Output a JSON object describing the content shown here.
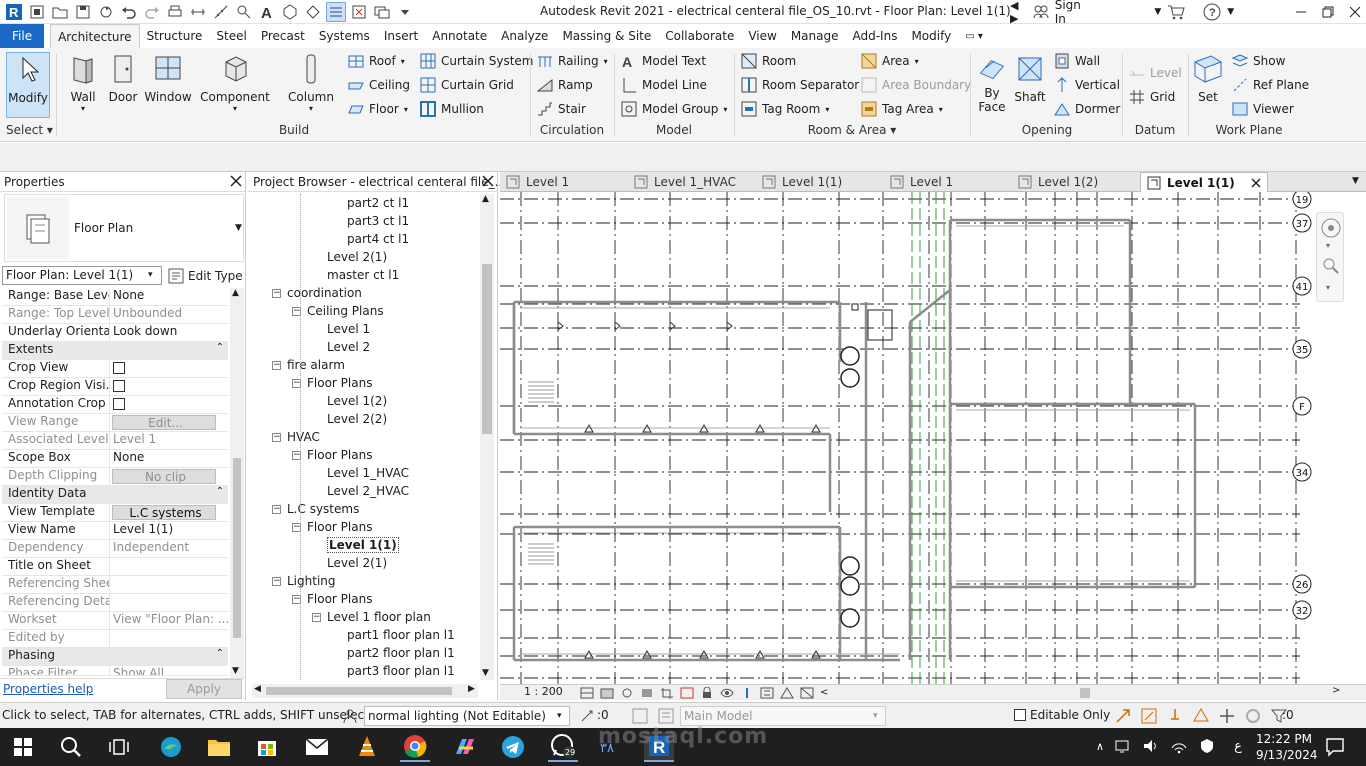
{
  "window": {
    "title": "Autodesk Revit 2021 - electrical centeral file_OS_10.rvt - Floor Plan: Level 1(1)",
    "sign_in": "Sign In"
  },
  "ribbon_tabs": [
    "File",
    "Architecture",
    "Structure",
    "Steel",
    "Precast",
    "Systems",
    "Insert",
    "Annotate",
    "Analyze",
    "Massing & Site",
    "Collaborate",
    "View",
    "Manage",
    "Add-Ins",
    "Modify"
  ],
  "ribbon": {
    "select": {
      "modify": "Modify",
      "label": "Select"
    },
    "build": {
      "wall": "Wall",
      "door": "Door",
      "window": "Window",
      "component": "Component",
      "column": "Column",
      "roof": "Roof",
      "ceiling": "Ceiling",
      "floor": "Floor",
      "curtain_system": "Curtain System",
      "curtain_grid": "Curtain Grid",
      "mullion": "Mullion",
      "label": "Build"
    },
    "circulation": {
      "railing": "Railing",
      "ramp": "Ramp",
      "stair": "Stair",
      "label": "Circulation"
    },
    "model": {
      "model_text": "Model Text",
      "model_line": "Model Line",
      "model_group": "Model Group",
      "label": "Model"
    },
    "room_area": {
      "room": "Room",
      "room_separator": "Room Separator",
      "tag_room": "Tag Room",
      "area": "Area",
      "area_boundary": "Area Boundary",
      "tag_area": "Tag Area",
      "label": "Room & Area"
    },
    "opening": {
      "by_face_1": "By",
      "by_face_2": "Face",
      "shaft": "Shaft",
      "wall": "Wall",
      "vertical": "Vertical",
      "dormer": "Dormer",
      "label": "Opening"
    },
    "datum": {
      "level": "Level",
      "grid": "Grid",
      "label": "Datum"
    },
    "work_plane": {
      "set": "Set",
      "show": "Show",
      "ref_plane": "Ref Plane",
      "viewer": "Viewer",
      "label": "Work Plane"
    }
  },
  "properties": {
    "title": "Properties",
    "type_name": "Floor Plan",
    "selector": "Floor Plan: Level 1(1)",
    "edit_type": "Edit Type",
    "rows": [
      {
        "k": "Range: Base Level",
        "v": "None"
      },
      {
        "k": "Range: Top Level",
        "v": "Unbounded"
      },
      {
        "k": "Underlay Orienta...",
        "v": "Look down"
      }
    ],
    "extents_label": "Extents",
    "extents": [
      {
        "k": "Crop View",
        "v": ""
      },
      {
        "k": "Crop Region Visi...",
        "v": ""
      },
      {
        "k": "Annotation Crop",
        "v": ""
      },
      {
        "k": "View Range",
        "v": "Edit..."
      },
      {
        "k": "Associated Level",
        "v": "Level 1"
      },
      {
        "k": "Scope Box",
        "v": "None"
      },
      {
        "k": "Depth Clipping",
        "v": "No clip"
      }
    ],
    "identity_label": "Identity Data",
    "identity": [
      {
        "k": "View Template",
        "v": "L.C systems"
      },
      {
        "k": "View Name",
        "v": "Level 1(1)"
      },
      {
        "k": "Dependency",
        "v": "Independent"
      },
      {
        "k": "Title on Sheet",
        "v": ""
      },
      {
        "k": "Referencing Sheet",
        "v": ""
      },
      {
        "k": "Referencing Detail",
        "v": ""
      },
      {
        "k": "Workset",
        "v": "View \"Floor Plan: ..."
      },
      {
        "k": "Edited by",
        "v": ""
      }
    ],
    "phasing_label": "Phasing",
    "phase_filter": {
      "k": "Phase Filter",
      "v": "Show All"
    },
    "help": "Properties help",
    "apply": "Apply"
  },
  "project_browser": {
    "title": "Project Browser - electrical centeral file_...",
    "nodes": [
      {
        "level": 3,
        "text": "part2 ct l1",
        "toggle": ""
      },
      {
        "level": 3,
        "text": "part3 ct l1",
        "toggle": ""
      },
      {
        "level": 3,
        "text": "part4 ct l1",
        "toggle": ""
      },
      {
        "level": 2,
        "text": "Level 2(1)",
        "toggle": ""
      },
      {
        "level": 2,
        "text": "master ct l1",
        "toggle": ""
      },
      {
        "level": 0,
        "text": "coordination",
        "toggle": "−"
      },
      {
        "level": 1,
        "text": "Ceiling Plans",
        "toggle": "−"
      },
      {
        "level": 2,
        "text": "Level 1",
        "toggle": ""
      },
      {
        "level": 2,
        "text": "Level 2",
        "toggle": ""
      },
      {
        "level": 0,
        "text": "fire alarm",
        "toggle": "−"
      },
      {
        "level": 1,
        "text": "Floor Plans",
        "toggle": "−"
      },
      {
        "level": 2,
        "text": "Level 1(2)",
        "toggle": ""
      },
      {
        "level": 2,
        "text": "Level 2(2)",
        "toggle": ""
      },
      {
        "level": 0,
        "text": "HVAC",
        "toggle": "−"
      },
      {
        "level": 1,
        "text": "Floor Plans",
        "toggle": "−"
      },
      {
        "level": 2,
        "text": "Level 1_HVAC",
        "toggle": ""
      },
      {
        "level": 2,
        "text": "Level 2_HVAC",
        "toggle": ""
      },
      {
        "level": 0,
        "text": "L.C systems",
        "toggle": "−"
      },
      {
        "level": 1,
        "text": "Floor Plans",
        "toggle": "−"
      },
      {
        "level": 2,
        "text": "Level 1(1)",
        "toggle": "",
        "bold": true
      },
      {
        "level": 2,
        "text": "Level 2(1)",
        "toggle": ""
      },
      {
        "level": 0,
        "text": "Lighting",
        "toggle": "−"
      },
      {
        "level": 1,
        "text": "Floor Plans",
        "toggle": "−"
      },
      {
        "level": 2,
        "text": "Level 1 floor plan",
        "toggle": "−"
      },
      {
        "level": 3,
        "text": "part1 floor plan l1",
        "toggle": ""
      },
      {
        "level": 3,
        "text": "part2 floor plan l1",
        "toggle": ""
      },
      {
        "level": 3,
        "text": "part3 floor plan l1",
        "toggle": ""
      },
      {
        "level": 3,
        "text": "part4 floor plan l1",
        "toggle": ""
      }
    ]
  },
  "view_tabs": [
    {
      "label": "Level 1"
    },
    {
      "label": "Level 1_HVAC"
    },
    {
      "label": "Level 1(1)"
    },
    {
      "label": "Level 1"
    },
    {
      "label": "Level 1(2)"
    },
    {
      "label": "Level 1(1)",
      "active": true
    }
  ],
  "grid_bubbles": [
    "19",
    "37",
    "41",
    "35",
    "F",
    "34",
    "26",
    "32"
  ],
  "view_bar": {
    "scale": "1 : 200"
  },
  "status": {
    "hint": "Click to select, TAB for alternates, CTRL adds, SHIFT unselects.",
    "workset": "normal lighting (Not Editable)",
    "count": ":0",
    "model": "Main Model",
    "editable_only": "Editable Only",
    "filter_count": ":0"
  },
  "taskbar": {
    "time": "12:22 PM",
    "date": "9/13/2024",
    "lang": "ع"
  },
  "watermark": "mostaql.com",
  "colors": {
    "file_tab": "#1a69c4",
    "taskbar": "#1f1f1f",
    "ribbon_bg": "#f4f4f4"
  }
}
